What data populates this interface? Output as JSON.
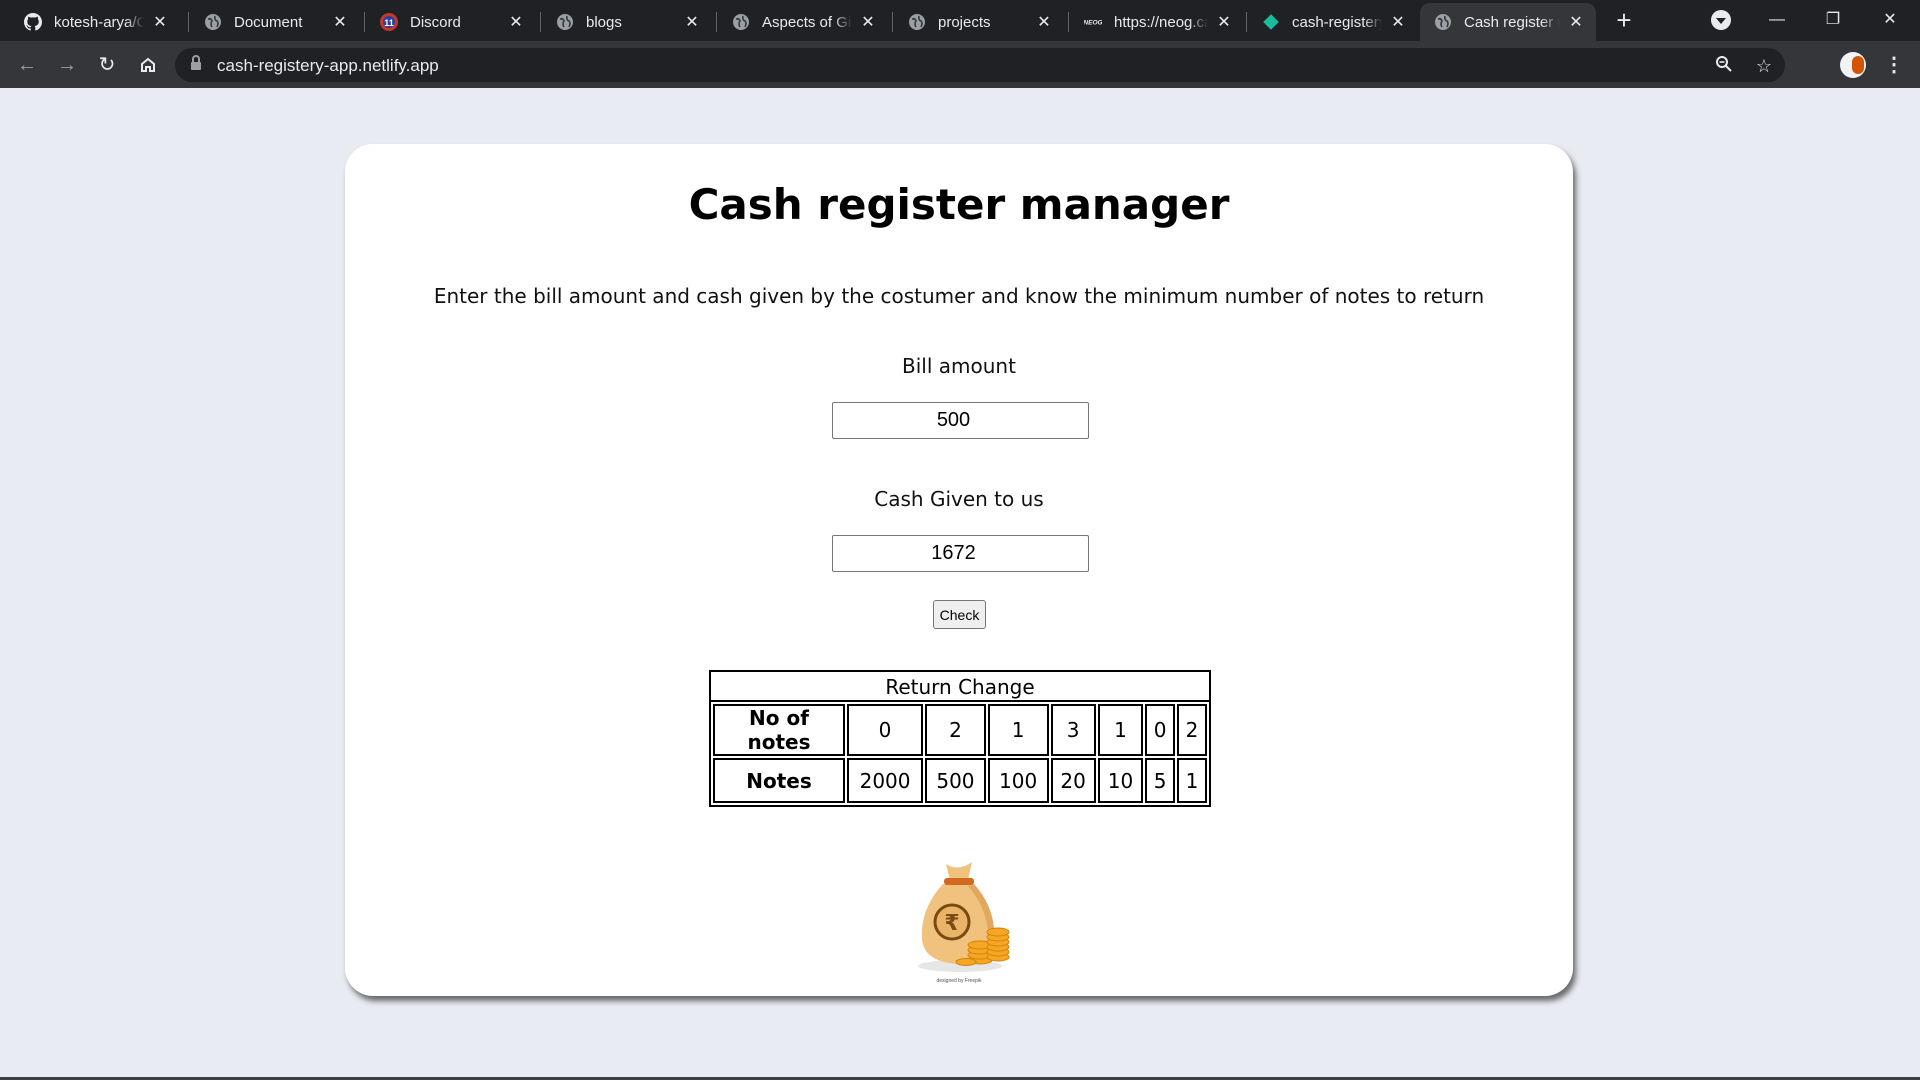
{
  "browser": {
    "tabs": [
      {
        "title": "kotesh-arya/Cash-register",
        "favicon": "github-icon"
      },
      {
        "title": "Document",
        "favicon": "globe-icon"
      },
      {
        "title": "Discord",
        "favicon": "discord-icon"
      },
      {
        "title": "blogs",
        "favicon": "globe-icon"
      },
      {
        "title": "Aspects of GitHub",
        "favicon": "globe-icon"
      },
      {
        "title": "projects",
        "favicon": "globe-icon"
      },
      {
        "title": "https://neog.camp",
        "favicon": "neog-icon"
      },
      {
        "title": "cash-registery",
        "favicon": "netlify-icon"
      },
      {
        "title": "Cash register manager",
        "favicon": "globe-icon",
        "active": true
      }
    ],
    "url": "cash-registery-app.netlify.app"
  },
  "page": {
    "title": "Cash register manager",
    "description": "Enter the bill amount and cash given by the costumer and know the minimum number of notes to return",
    "bill_label": "Bill amount",
    "bill_value": "500",
    "cash_label": "Cash Given to us",
    "cash_value": "1672",
    "check_label": "Check",
    "table": {
      "caption": "Return Change",
      "row1_header": "No of notes",
      "counts": [
        "0",
        "2",
        "1",
        "3",
        "1",
        "0",
        "2"
      ],
      "row2_header": "Notes",
      "notes": [
        "2000",
        "500",
        "100",
        "20",
        "10",
        "5",
        "1"
      ]
    },
    "image_credit": "designed by Freepik"
  },
  "colors": {
    "page_bg": "#e8ebf2",
    "card_bg": "#ffffff",
    "chrome_dark": "#202124",
    "chrome_toolbar": "#35363a"
  }
}
